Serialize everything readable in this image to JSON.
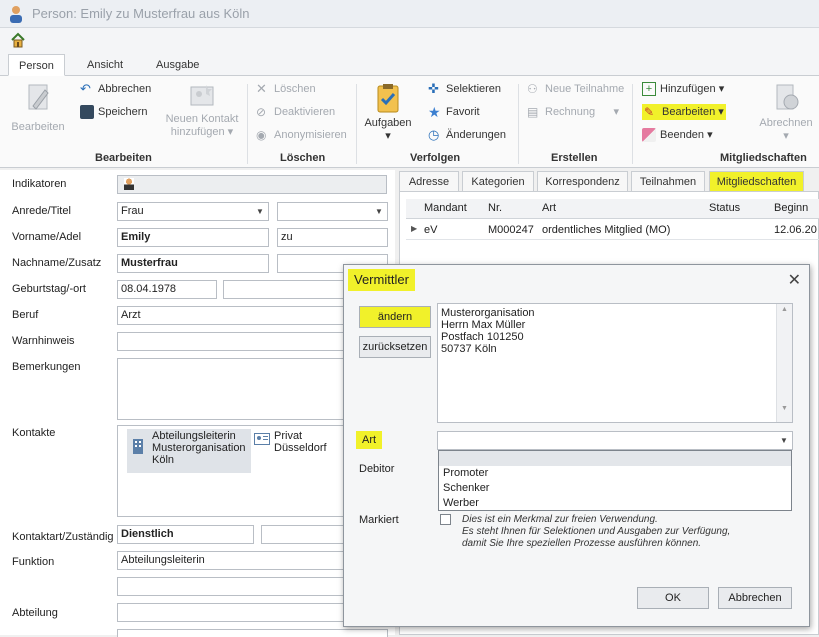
{
  "window": {
    "title": "Person: Emily zu Musterfrau aus Köln"
  },
  "ribbon_tabs": [
    "Person",
    "Ansicht",
    "Ausgabe"
  ],
  "ribbon": {
    "bearbeiten_btn": "Bearbeiten",
    "abbrechen": "Abbrechen",
    "speichern": "Speichern",
    "neuer_kontakt_1": "Neuen Kontakt",
    "neuer_kontakt_2": "hinzufügen",
    "loeschen": "Löschen",
    "deaktivieren": "Deaktivieren",
    "anonymisieren": "Anonymisieren",
    "aufgaben": "Aufgaben",
    "selektieren": "Selektieren",
    "favorit": "Favorit",
    "aenderungen": "Änderungen",
    "neue_teilnahme": "Neue Teilnahme",
    "rechnung": "Rechnung",
    "hinzufuegen": "Hinzufügen",
    "bearbeiten_ms": "Bearbeiten",
    "beenden": "Beenden",
    "abrechnen": "Abrechnen",
    "groups": [
      "Bearbeiten",
      "Löschen",
      "Verfolgen",
      "Erstellen",
      "Mitgliedschaften"
    ]
  },
  "form": {
    "labels": {
      "indikatoren": "Indikatoren",
      "anrede": "Anrede/Titel",
      "vorname": "Vorname/Adel",
      "nachname": "Nachname/Zusatz",
      "geburtstag": "Geburtstag/-ort",
      "beruf": "Beruf",
      "warnhinweis": "Warnhinweis",
      "bemerkungen": "Bemerkungen",
      "kontakte": "Kontakte",
      "kontaktart": "Kontaktart/Zuständig",
      "funktion": "Funktion",
      "abteilung": "Abteilung"
    },
    "values": {
      "anrede": "Frau",
      "vorname": "Emily",
      "adel": "zu",
      "nachname": "Musterfrau",
      "geburtstag": "08.04.1978",
      "beruf": "Arzt",
      "kontaktart": "Dienstlich",
      "funktion": "Abteilungsleiterin"
    },
    "kontakte": [
      {
        "lines": [
          "Abteilungsleiterin",
          "Musterorganisation",
          "Köln"
        ]
      },
      {
        "lines": [
          "Privat",
          "Düsseldorf"
        ]
      }
    ]
  },
  "content_tabs": [
    "Adresse",
    "Kategorien",
    "Korrespondenz",
    "Teilnahmen",
    "Mitgliedschaften"
  ],
  "grid": {
    "headers": [
      "Mandant",
      "Nr.",
      "Art",
      "Status",
      "Beginn"
    ],
    "rows": [
      [
        "eV",
        "M000247",
        "ordentliches Mitglied (MO)",
        "",
        "12.06.20"
      ]
    ]
  },
  "dialog": {
    "title": "Vermittler",
    "aendern": "ändern",
    "zuruecksetzen": "zurücksetzen",
    "address": [
      "Musterorganisation",
      "Herrn Max Müller",
      "Postfach 101250",
      "50737 Köln"
    ],
    "art_label": "Art",
    "debitor_label": "Debitor",
    "markiert_label": "Markiert",
    "art_options": [
      "Promoter",
      "Schenker",
      "Werber"
    ],
    "markiert_note": [
      "Dies ist ein Merkmal zur freien Verwendung.",
      "Es steht Ihnen für Selektionen und Ausgaben zur Verfügung,",
      "damit Sie Ihre speziellen Prozesse ausführen können."
    ],
    "ok": "OK",
    "cancel": "Abbrechen"
  },
  "colors": {
    "highlight": "#f1f12a",
    "tab_active": "#ffffff"
  }
}
